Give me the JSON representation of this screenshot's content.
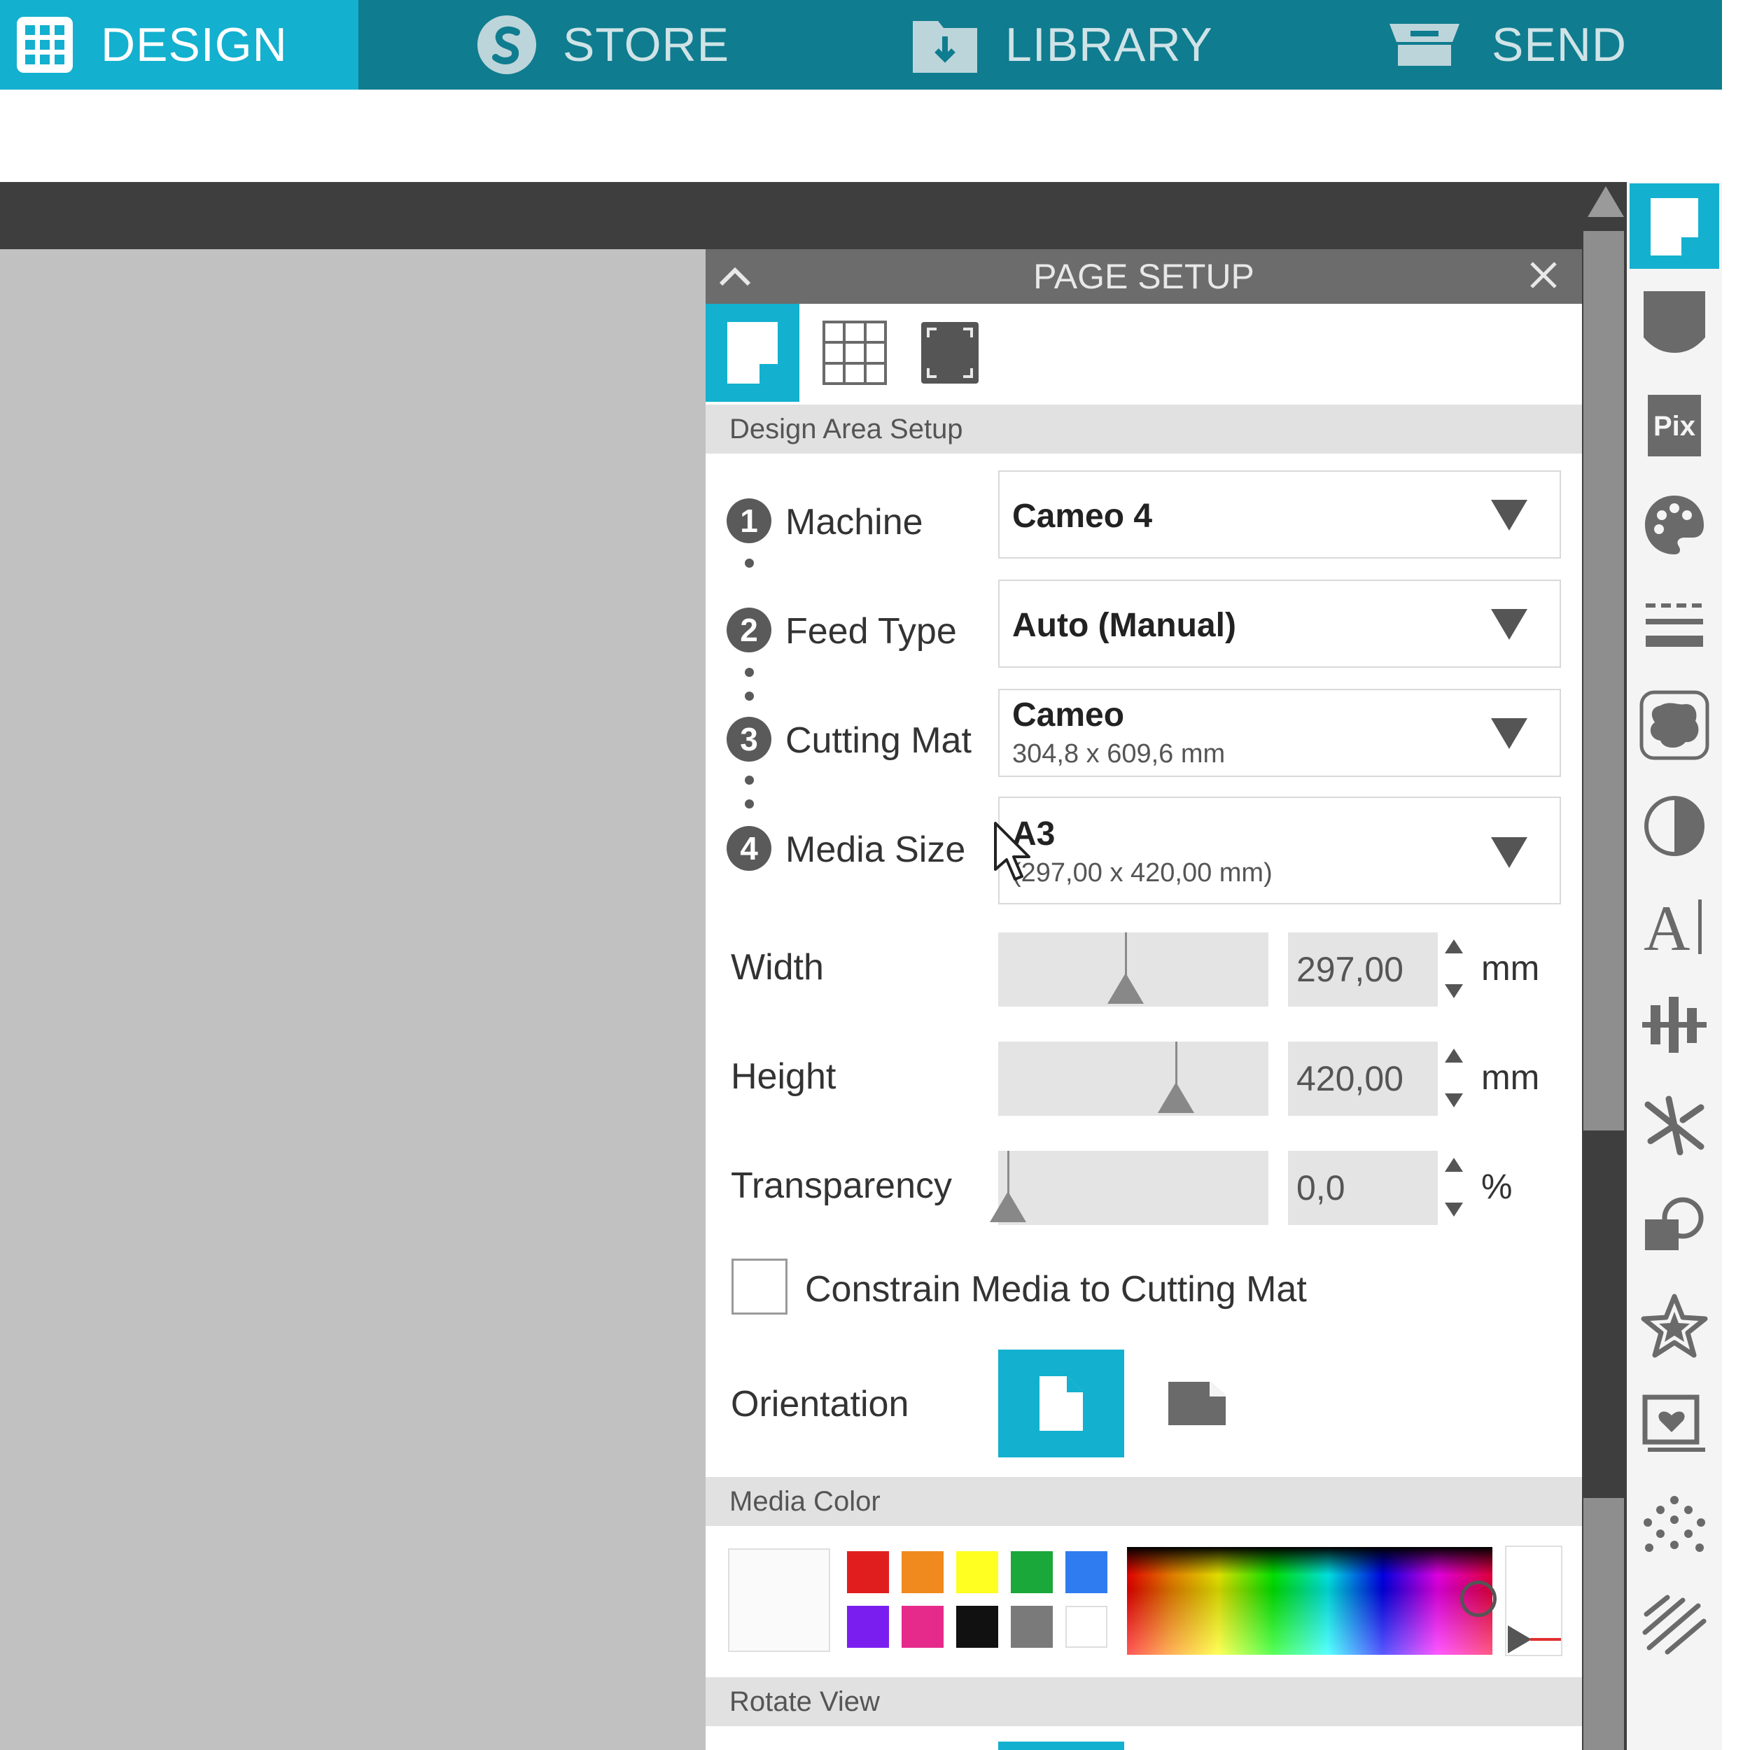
{
  "nav": {
    "tabs": [
      {
        "label": "DESIGN",
        "icon": "grid-icon",
        "active": true
      },
      {
        "label": "STORE",
        "icon": "silhouette-store-icon",
        "active": false
      },
      {
        "label": "LIBRARY",
        "icon": "folder-download-icon",
        "active": false
      },
      {
        "label": "SEND",
        "icon": "cutter-machine-icon",
        "active": false
      }
    ]
  },
  "panel": {
    "title": "PAGE SETUP",
    "tabs": [
      "page-icon",
      "grid-icon",
      "border-icon"
    ],
    "design_area_title": "Design Area Setup",
    "steps": [
      {
        "num": "1",
        "label": "Machine",
        "value": "Cameo 4",
        "sub": ""
      },
      {
        "num": "2",
        "label": "Feed Type",
        "value": "Auto (Manual)",
        "sub": ""
      },
      {
        "num": "3",
        "label": "Cutting Mat",
        "value": "Cameo",
        "sub": "304,8 x 609,6 mm"
      },
      {
        "num": "4",
        "label": "Media Size",
        "value": "A3",
        "sub": "(297,00 x 420,00 mm)"
      }
    ],
    "width": {
      "label": "Width",
      "value": "297,00",
      "unit": "mm",
      "slider_fraction": 0.47
    },
    "height": {
      "label": "Height",
      "value": "420,00",
      "unit": "mm",
      "slider_fraction": 0.67
    },
    "transparency": {
      "label": "Transparency",
      "value": "0,0",
      "unit": "%",
      "slider_fraction": 0.0
    },
    "constrain_label": "Constrain Media to Cutting Mat",
    "constrain_checked": false,
    "orientation_label": "Orientation",
    "orientation_selected": "portrait",
    "media_color_title": "Media Color",
    "swatches": [
      "#e01e1e",
      "#f08a1e",
      "#ffff22",
      "#1aa83a",
      "#2f7cf0",
      "#7a1ef0",
      "#e62a8c",
      "#111111",
      "#7a7a7a",
      "#ffffff"
    ],
    "rotate_view_title": "Rotate View"
  },
  "colors": {
    "accent": "#13b0cf",
    "nav_bg": "#0f7c8f",
    "canvas": "#c1c1c1"
  },
  "right_toolbar": [
    "page-setup-icon",
    "registration-marks-icon",
    "pix-scan-icon",
    "palette-icon",
    "line-style-icon",
    "fill-pattern-icon",
    "contrast-icon",
    "text-style-icon",
    "align-icon",
    "replicate-icon",
    "transform-icon",
    "favorites-star-icon",
    "library-heart-icon",
    "rhinestone-icon",
    "sketch-icon"
  ]
}
